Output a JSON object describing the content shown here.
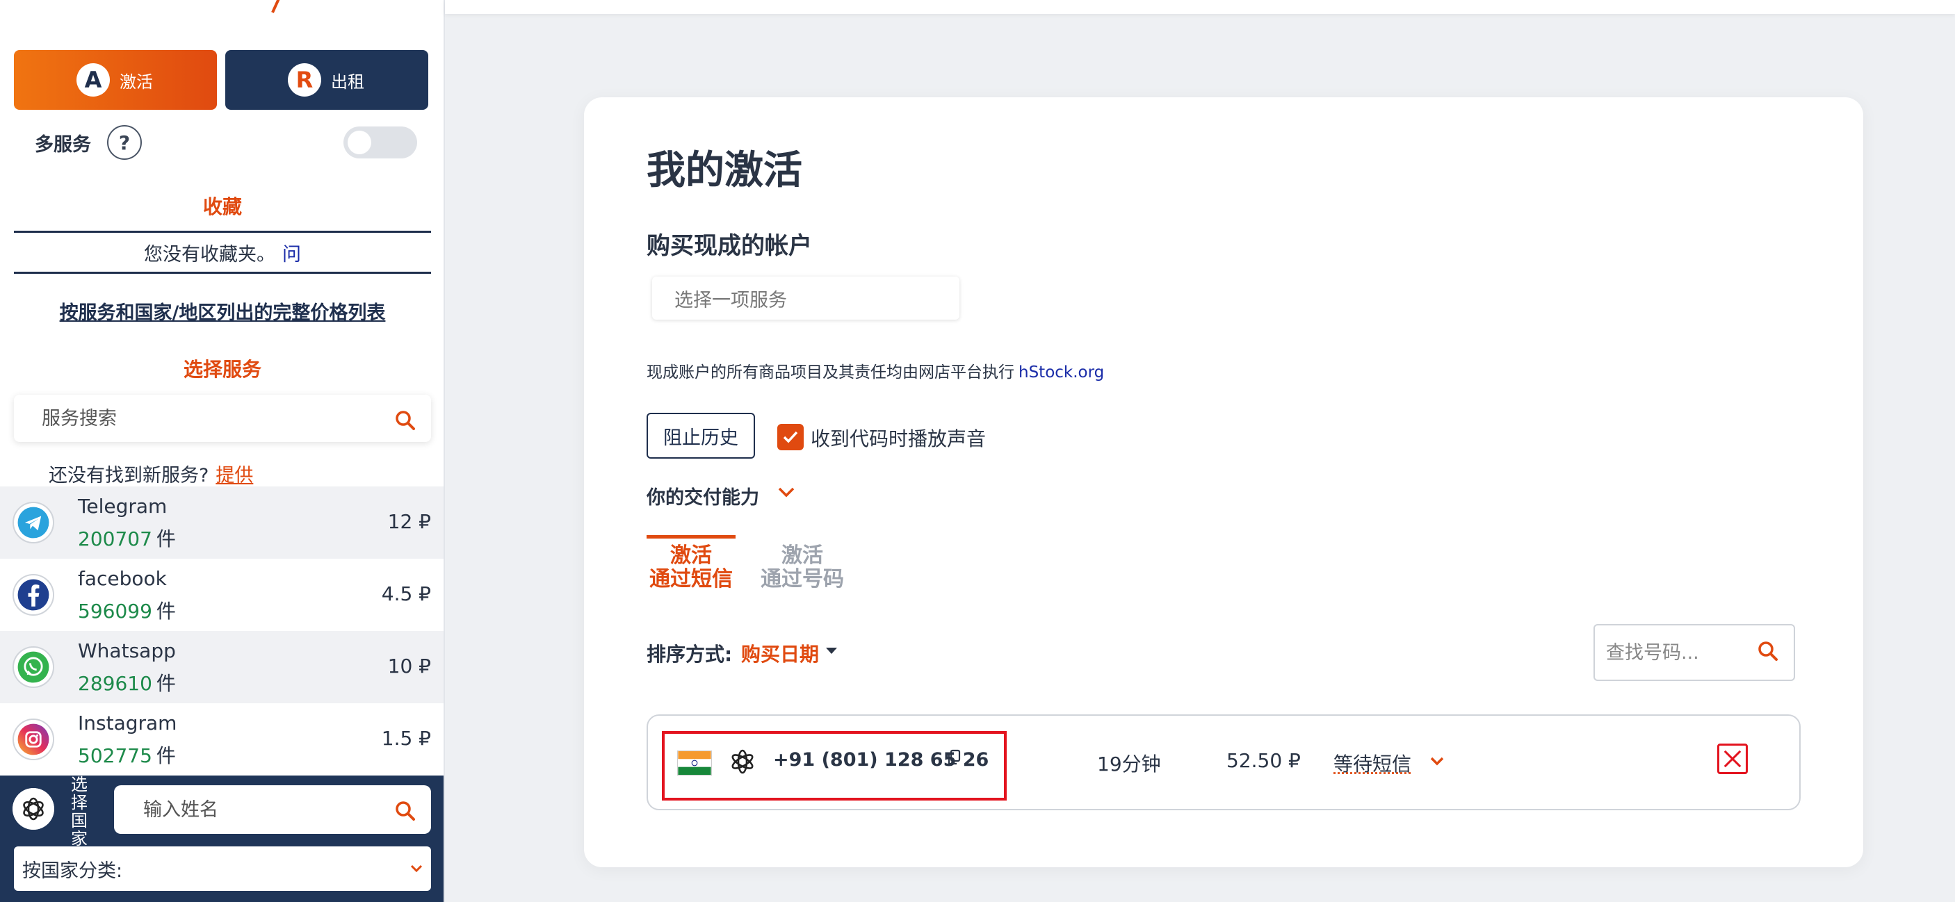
{
  "sidebar": {
    "mode_buttons": {
      "activation": {
        "icon_letter": "A",
        "label": "激活"
      },
      "rent": {
        "icon_letter": "R",
        "label": "出租"
      }
    },
    "multi_service": {
      "label": "多服务",
      "help": "?",
      "enabled": false
    },
    "favorites": {
      "title": "收藏",
      "empty_text": "您没有收藏夹。",
      "help_link": "问"
    },
    "price_list_link": "按服务和国家/地区列出的完整价格列表",
    "choose_service": "选择服务",
    "service_search": {
      "placeholder": "服务搜索"
    },
    "not_found": {
      "text": "还没有找到新服务?",
      "link": "提供"
    },
    "services": [
      {
        "name": "Telegram",
        "count": "200707",
        "unit": "件",
        "price": "12 ₽",
        "icon": "telegram-icon"
      },
      {
        "name": "facebook",
        "count": "596099",
        "unit": "件",
        "price": "4.5 ₽",
        "icon": "facebook-icon"
      },
      {
        "name": "Whatsapp",
        "count": "289610",
        "unit": "件",
        "price": "10 ₽",
        "icon": "whatsapp-icon"
      },
      {
        "name": "Instagram",
        "count": "502775",
        "unit": "件",
        "price": "1.5 ₽",
        "icon": "instagram-icon"
      }
    ],
    "country": {
      "vertical_label": "选择国家",
      "name_search_placeholder": "输入姓名",
      "sort_label": "按国家分类:"
    }
  },
  "main": {
    "title": "我的激活",
    "buy_ready_title": "购买现成的帐户",
    "service_select_placeholder": "选择一项服务",
    "notice": {
      "text": "现成账户的所有商品项目及其责任均由网店平台执行",
      "site": "hStock.org"
    },
    "block_history": "阻止历史",
    "sound_option": {
      "label": "收到代码时播放声音",
      "checked": true
    },
    "payment_ability": "你的交付能力",
    "tabs": [
      {
        "line1": "激活",
        "line2": "通过短信",
        "active": true
      },
      {
        "line1": "激活",
        "line2": "通过号码",
        "active": false
      }
    ],
    "sort": {
      "label": "排序方式:",
      "value": "购买日期"
    },
    "number_search_placeholder": "查找号码...",
    "activations": [
      {
        "country": "India",
        "service_icon": "openai-icon",
        "phone": "+91 (801) 128 65 26",
        "time_left": "19分钟",
        "price": "52.50 ₽",
        "status": "等待短信"
      }
    ]
  },
  "colors": {
    "accent": "#e04a10",
    "navy": "#1f3558",
    "green": "#1d8a4a",
    "highlight": "#e3141f"
  }
}
